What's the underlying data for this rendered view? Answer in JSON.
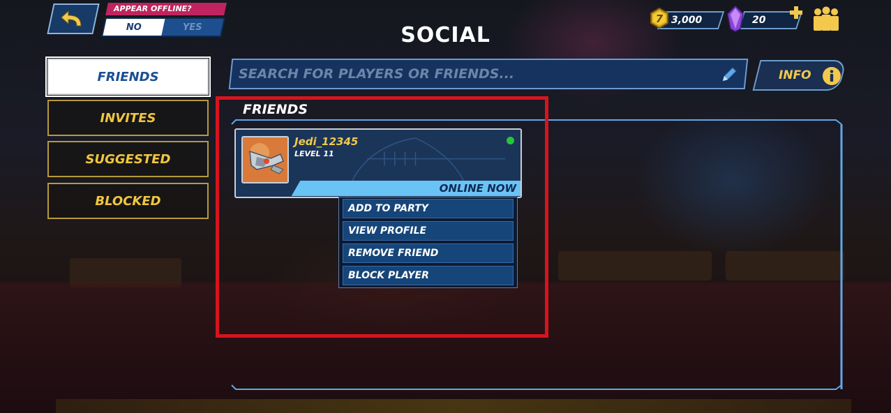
{
  "header": {
    "title": "SOCIAL",
    "appear_offline_label": "APPEAR OFFLINE?",
    "toggle_no": "NO",
    "toggle_yes": "YES",
    "coins": "3,000",
    "gems": "20"
  },
  "sidebar": {
    "tabs": [
      {
        "label": "FRIENDS",
        "active": true
      },
      {
        "label": "INVITES",
        "active": false
      },
      {
        "label": "SUGGESTED",
        "active": false
      },
      {
        "label": "BLOCKED",
        "active": false
      }
    ]
  },
  "search": {
    "placeholder": "SEARCH FOR PLAYERS OR FRIENDS..."
  },
  "info": {
    "label": "INFO"
  },
  "friends": {
    "section_title": "FRIENDS",
    "card": {
      "name": "Jedi_12345",
      "level": "LEVEL 11",
      "status": "ONLINE NOW"
    }
  },
  "context_menu": {
    "items": [
      "ADD TO PARTY",
      "VIEW PROFILE",
      "REMOVE FRIEND",
      "BLOCK PLAYER"
    ]
  },
  "colors": {
    "accent_gold": "#f2c94c",
    "accent_blue": "#6ac3f5",
    "online_green": "#27c53a",
    "highlight_red": "#d7141e"
  }
}
